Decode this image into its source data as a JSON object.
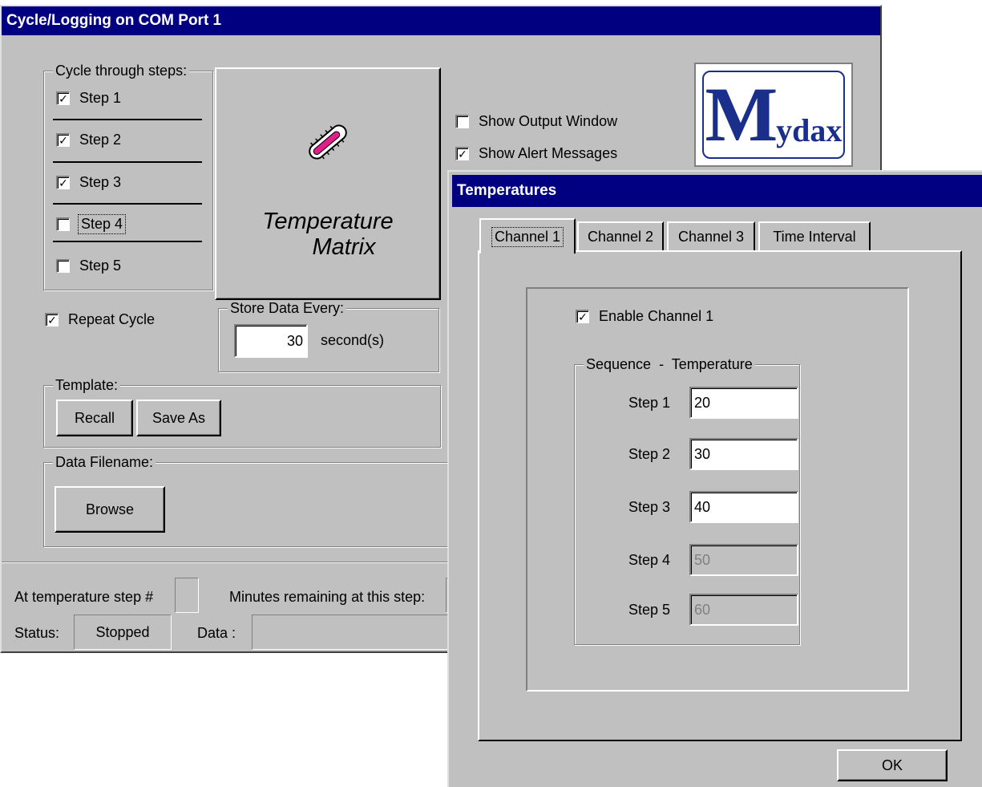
{
  "main_window": {
    "title": "Cycle/Logging on COM Port  1",
    "cycle_group": {
      "label": "Cycle through steps:",
      "steps": [
        {
          "label": "Step 1",
          "checked": true
        },
        {
          "label": "Step 2",
          "checked": true
        },
        {
          "label": "Step 3",
          "checked": true
        },
        {
          "label": "Step 4",
          "checked": false
        },
        {
          "label": "Step 5",
          "checked": false
        }
      ]
    },
    "temperature_matrix_button": {
      "line1": "Temperature",
      "line2": "Matrix",
      "icon": "thermometer-icon"
    },
    "show_output_window": {
      "label": "Show Output Window",
      "checked": false
    },
    "show_alert_messages": {
      "label": "Show Alert Messages",
      "checked": true
    },
    "logo": {
      "text_big": "M",
      "text_small": "ydax"
    },
    "repeat_cycle": {
      "label": "Repeat Cycle",
      "checked": true
    },
    "store_data": {
      "label": "Store Data Every:",
      "value": "30",
      "unit": "second(s)"
    },
    "template": {
      "label": "Template:",
      "recall": "Recall",
      "save_as": "Save As"
    },
    "data_filename": {
      "label": "Data Filename:",
      "browse": "Browse"
    },
    "status_bar": {
      "step_label": "At temperature step #",
      "step_value": "",
      "minutes_label": "Minutes remaining at this step:",
      "status_label": "Status:",
      "status_value": "Stopped",
      "data_label": "Data :",
      "data_value": ""
    }
  },
  "temps_dialog": {
    "title": "Temperatures",
    "tabs": [
      "Channel 1",
      "Channel 2",
      "Channel 3",
      "Time Interval"
    ],
    "active_tab": "Channel 1",
    "enable_channel": {
      "label": "Enable Channel 1",
      "checked": true
    },
    "sequence_label": "Sequence  -  Temperature",
    "steps": [
      {
        "label": "Step 1",
        "value": "20",
        "enabled": true
      },
      {
        "label": "Step 2",
        "value": "30",
        "enabled": true
      },
      {
        "label": "Step 3",
        "value": "40",
        "enabled": true
      },
      {
        "label": "Step 4",
        "value": "50",
        "enabled": false
      },
      {
        "label": "Step 5",
        "value": "60",
        "enabled": false
      }
    ],
    "ok": "OK"
  },
  "colors": {
    "title_bar": "#000080",
    "face": "#c0c0c0",
    "logo_blue": "#1a2f8c"
  }
}
